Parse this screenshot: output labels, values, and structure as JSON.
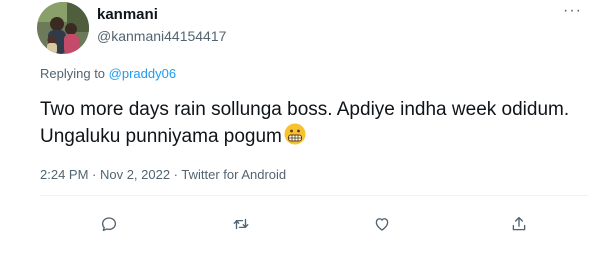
{
  "author": {
    "display_name": "kanmani",
    "handle": "@kanmani44154417"
  },
  "reply": {
    "prefix": "Replying to ",
    "mention": "@praddy06"
  },
  "tweet": {
    "text": "Two more days rain sollunga boss. Apdiye indha week odidum. Ungaluku punniyama pogum",
    "emoji": "grimacing-face"
  },
  "meta": {
    "timestamp": "2:24 PM · Nov 2, 2022 · Twitter for Android"
  },
  "menu": {
    "more_label": "···"
  },
  "actions": [
    {
      "icon": "reply-icon"
    },
    {
      "icon": "retweet-icon"
    },
    {
      "icon": "like-icon"
    },
    {
      "icon": "share-icon"
    }
  ],
  "colors": {
    "text": "#0f1419",
    "secondary": "#536471",
    "link": "#1d9bf0",
    "divider": "#eff3f4"
  }
}
